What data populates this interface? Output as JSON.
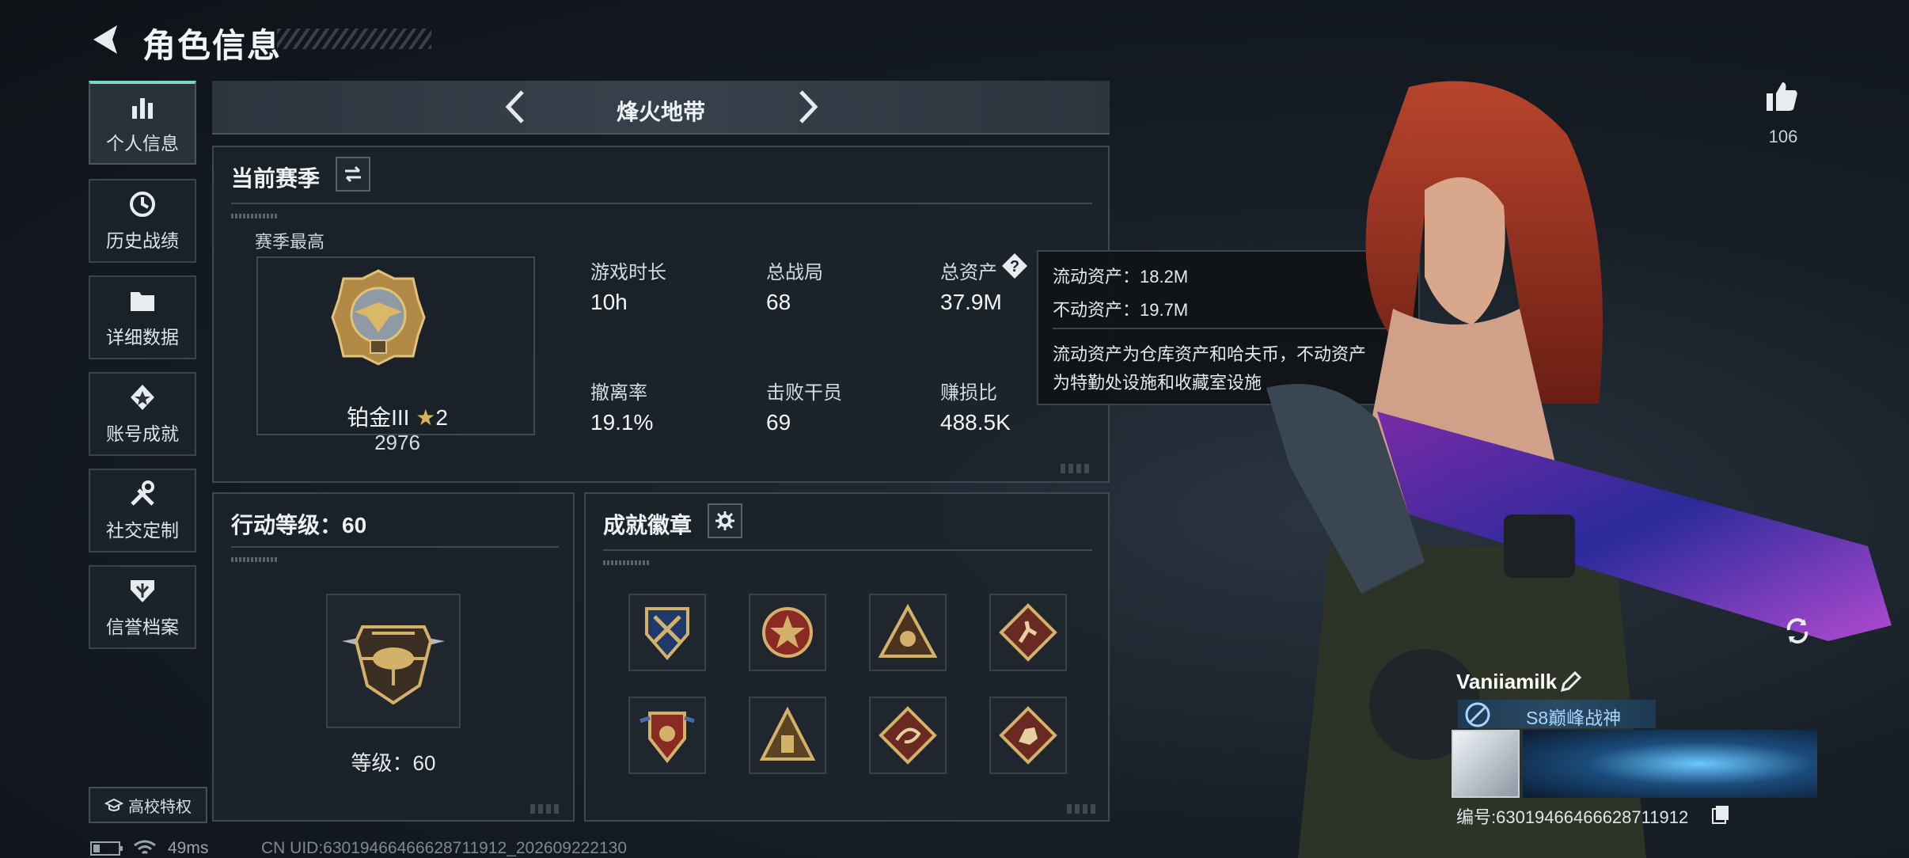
{
  "header": {
    "title": "角色信息"
  },
  "nav": {
    "items": [
      {
        "label": "个人信息",
        "icon": "bar-chart-icon"
      },
      {
        "label": "历史战绩",
        "icon": "clock-icon"
      },
      {
        "label": "详细数据",
        "icon": "folder-icon"
      },
      {
        "label": "账号成就",
        "icon": "achievement-icon"
      },
      {
        "label": "社交定制",
        "icon": "tools-icon"
      },
      {
        "label": "信誉档案",
        "icon": "shield-icon"
      }
    ],
    "campus_label": "高校特权"
  },
  "mode": {
    "label": "烽火地带"
  },
  "season": {
    "title": "当前赛季",
    "best_label": "赛季最高",
    "rank_name": "铂金III",
    "rank_stars": "2",
    "rank_score": "2976",
    "stats": {
      "play_time_label": "游戏时长",
      "play_time": "10h",
      "matches_label": "总战局",
      "matches": "68",
      "assets_label": "总资产",
      "assets": "37.9M",
      "extract_label": "撤离率",
      "extract": "19.1%",
      "kills_label": "击败干员",
      "kills": "69",
      "profit_label": "赚损比",
      "profit": "488.5K"
    }
  },
  "tooltip": {
    "liquid": "流动资产：18.2M",
    "fixed": "不动资产：19.7M",
    "desc_line1": "流动资产为仓库资产和哈夫币，不动资产",
    "desc_line2": "为特勤处设施和收藏室设施"
  },
  "action_level": {
    "title": "行动等级：60",
    "level_text": "等级：60"
  },
  "badges": {
    "title": "成就徽章"
  },
  "likes": {
    "count": "106"
  },
  "player": {
    "name": "Vaniiamilk",
    "title": "S8巅峰战神",
    "id": "编号:63019466466628711912"
  },
  "status": {
    "ping": "49ms",
    "uid": "CN UID:63019466466628711912_202609222130"
  },
  "colors": {
    "accent": "#7fd6c0",
    "gold": "#c9a14a",
    "panel": "#1c232a"
  }
}
